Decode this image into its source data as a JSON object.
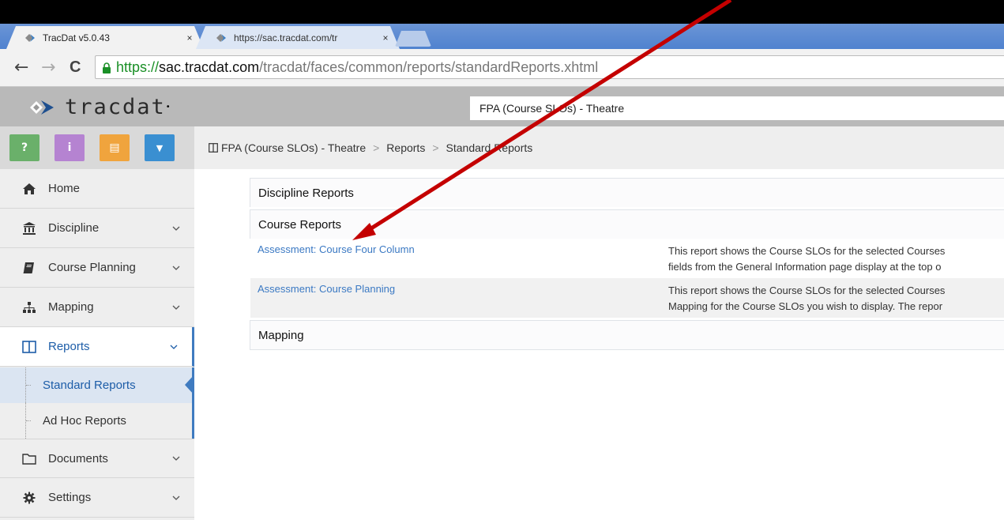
{
  "browser": {
    "tabs": [
      {
        "title": "TracDat v5.0.43",
        "close": "×",
        "active": true
      },
      {
        "title": "https://sac.tracdat.com/tr",
        "close": "×",
        "active": false
      }
    ],
    "nav": {
      "back": "←",
      "forward": "→",
      "reload": "C"
    },
    "url": {
      "scheme": "https://",
      "host": "sac.tracdat.com",
      "path": "/tracdat/faces/common/reports/standardReports.xhtml"
    }
  },
  "app": {
    "logo_text": "tracdat",
    "logo_mark": "•",
    "context": "FPA (Course SLOs) - Theatre"
  },
  "quickbar": {
    "buttons": [
      {
        "icon": "help-icon",
        "glyph": "?",
        "color": "#6ab06a"
      },
      {
        "icon": "info-icon",
        "glyph": "i",
        "color": "#b583d1"
      },
      {
        "icon": "notes-icon",
        "glyph": "▤",
        "color": "#f0a43d"
      },
      {
        "icon": "filter-icon",
        "glyph": "▼",
        "color": "#3a8fd1"
      }
    ]
  },
  "sidebar": {
    "items": [
      {
        "label": "Home",
        "icon": "home-icon"
      },
      {
        "label": "Discipline",
        "icon": "institution-icon"
      },
      {
        "label": "Course Planning",
        "icon": "book-icon"
      },
      {
        "label": "Mapping",
        "icon": "sitemap-icon"
      },
      {
        "label": "Reports",
        "icon": "columns-icon"
      },
      {
        "label": "Documents",
        "icon": "folder-icon"
      },
      {
        "label": "Settings",
        "icon": "gear-icon"
      }
    ],
    "sub_items": [
      {
        "label": "Standard Reports"
      },
      {
        "label": "Ad Hoc Reports"
      }
    ]
  },
  "breadcrumb": {
    "icon": "columns-icon",
    "items": [
      "FPA (Course SLOs) - Theatre",
      "Reports",
      "Standard Reports"
    ],
    "separator": ">"
  },
  "sections": {
    "discipline": "Discipline Reports",
    "course": "Course Reports",
    "mapping": "Mapping"
  },
  "reports": [
    {
      "link": "Assessment: Course Four Column",
      "desc_line1": "This report shows the Course SLOs for the selected Courses",
      "desc_line2": "fields from the General Information page display at the top o"
    },
    {
      "link": "Assessment: Course Planning",
      "desc_line1": "This report shows the Course SLOs for the selected Courses",
      "desc_line2": "Mapping for the Course SLOs you wish to display. The repor"
    }
  ],
  "colors": {
    "accent": "#3f7bc0",
    "link": "#3b79c3",
    "annotation_arrow": "#c40000"
  }
}
